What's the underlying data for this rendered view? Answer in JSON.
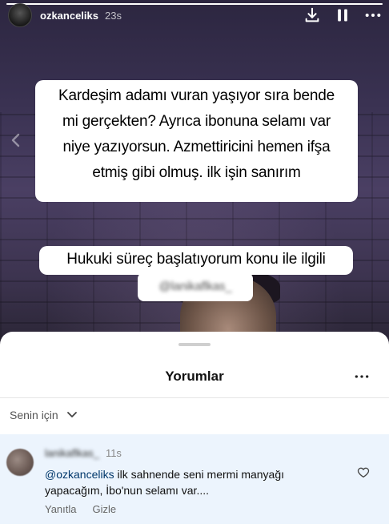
{
  "story": {
    "username": "ozkanceliks",
    "time": "23s",
    "progress_fraction": 1.0,
    "icons": [
      "download-icon",
      "pause-icon",
      "more-icon"
    ],
    "text_block_1": "Kardeşim adamı vuran yaşıyor sıra bende mi gerçekten? Ayrıca ibonuna selamı var niye yazıyorsun. Azmettiricini hemen ifşa etmiş gibi olmuş. ilk işin sanırım",
    "text_block_1_lines": [
      "Kardeşim adamı vuran yaşıyor sıra bende",
      "mi gerçekten? Ayrıca ibonuna selamı var",
      "niye yazıyorsun. Azmettiricini hemen ifşa",
      "etmiş gibi olmuş. ilk işin sanırım"
    ],
    "text_block_2": "Hukuki süreç başlatıyorum konu ile ilgili",
    "mention_blurred": "@lanikaflkas_"
  },
  "comments_sheet": {
    "title": "Yorumlar",
    "filter_label": "Senin için",
    "comment": {
      "username_blurred": "lanikaflkas_",
      "time": "11s",
      "mention": "@ozkanceliks",
      "text": " ilk sahnende seni mermi manyağı yapacağım,  İbo'nun selamı var....",
      "reply_label": "Yanıtla",
      "hide_label": "Gizle"
    }
  },
  "colors": {
    "mention_blue": "#00376b",
    "comment_highlight": "#ecf4fd",
    "sheet_bg": "#ffffff"
  }
}
